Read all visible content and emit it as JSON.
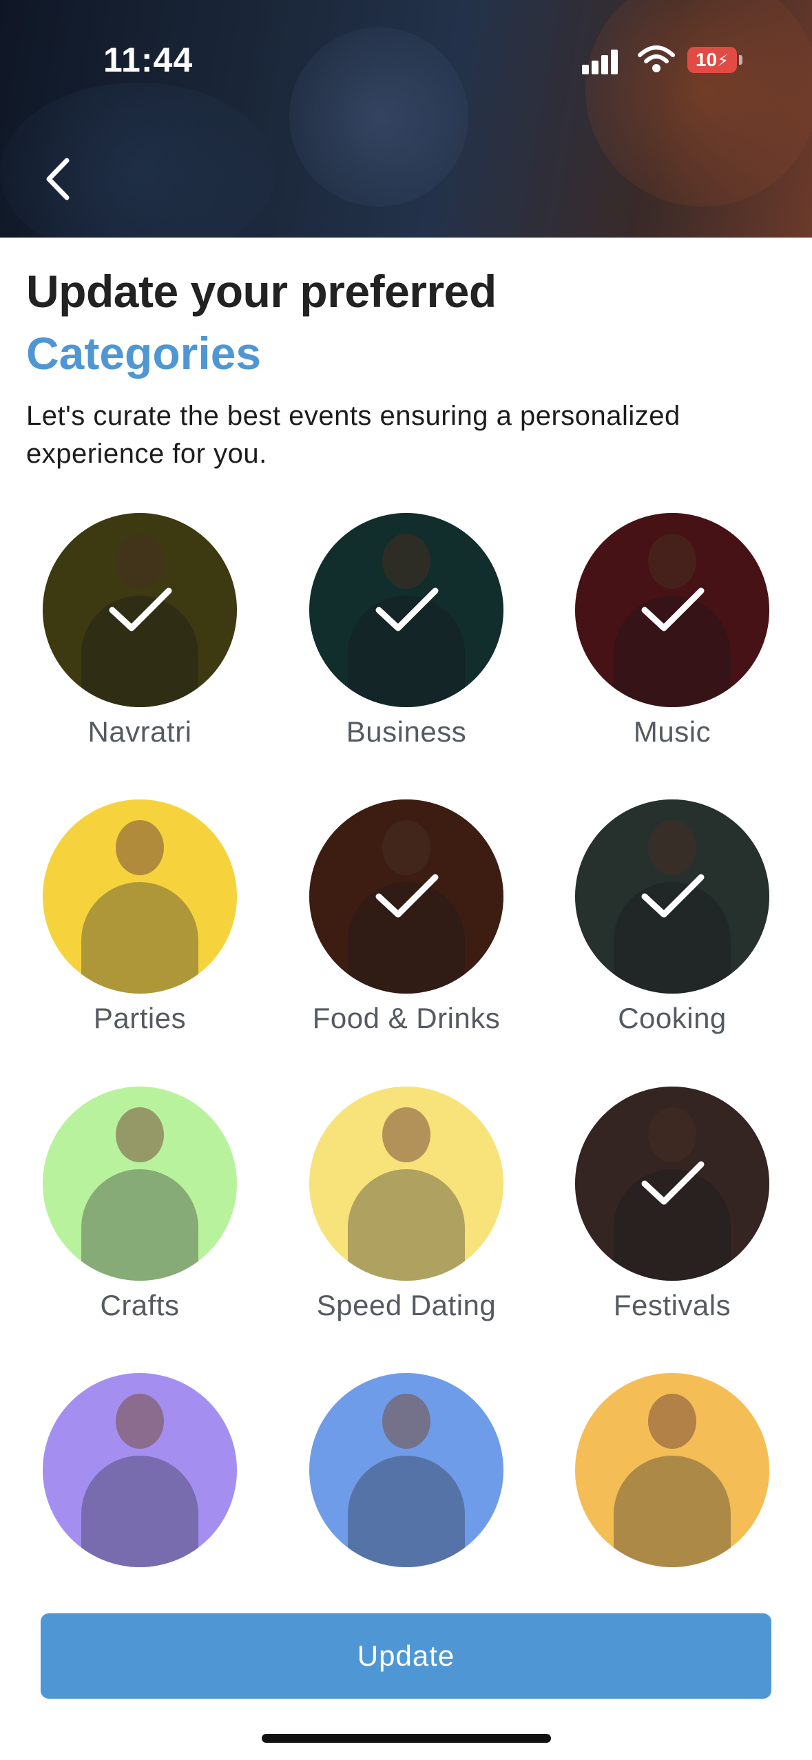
{
  "status_bar": {
    "time": "11:44",
    "battery": "10"
  },
  "icons": {
    "back": "chevron-left-icon",
    "check": "checkmark-icon",
    "signal": "signal-icon",
    "wifi": "wifi-icon",
    "battery": "battery-icon"
  },
  "header": {
    "title_line1": "Update your preferred",
    "title_line2": "Categories",
    "subtitle": "Let's curate the best events ensuring a personalized experience for you."
  },
  "categories": [
    {
      "label": "Navratri",
      "selected": true,
      "bg": "#6a6420"
    },
    {
      "label": "Business",
      "selected": true,
      "bg": "#1e4e4c"
    },
    {
      "label": "Music",
      "selected": true,
      "bg": "#7a1f25"
    },
    {
      "label": "Parties",
      "selected": false,
      "bg": "#f6d33c"
    },
    {
      "label": "Food & Drinks",
      "selected": true,
      "bg": "#6a3320"
    },
    {
      "label": "Cooking",
      "selected": true,
      "bg": "#42534f"
    },
    {
      "label": "Crafts",
      "selected": false,
      "bg": "#b9f29d"
    },
    {
      "label": "Speed Dating",
      "selected": false,
      "bg": "#f8e27a"
    },
    {
      "label": "Festivals",
      "selected": true,
      "bg": "#5a3f3c"
    },
    {
      "label": "",
      "selected": false,
      "bg": "#a48ff1"
    },
    {
      "label": "",
      "selected": false,
      "bg": "#6f9ce8"
    },
    {
      "label": "",
      "selected": false,
      "bg": "#f5bd55"
    }
  ],
  "actions": {
    "update_label": "Update"
  },
  "colors": {
    "accent": "#4f97d4",
    "title": "#222222",
    "label": "#555a60"
  }
}
